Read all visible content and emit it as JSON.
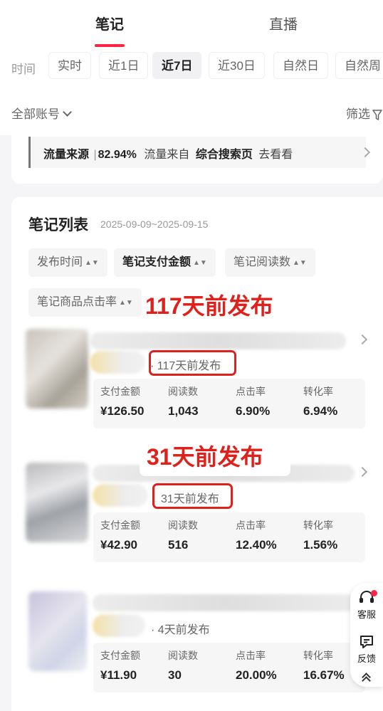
{
  "tabs": {
    "notes": "笔记",
    "live": "直播"
  },
  "time_filter": {
    "label": "时间",
    "options": [
      "实时",
      "近1日",
      "近7日",
      "近30日",
      "自然日",
      "自然周"
    ],
    "selected": "近7日"
  },
  "account_filter": {
    "label": "全部账号"
  },
  "filter_button": {
    "label": "筛选"
  },
  "traffic": {
    "label": "流量来源",
    "percent": "82.94%",
    "from_text": "流量来自",
    "source": "综合搜索页",
    "action": "去看看"
  },
  "note_list": {
    "title": "笔记列表",
    "date_range": "2025-09-09~2025-09-15",
    "sort_options": [
      "发布时间",
      "笔记支付金额",
      "笔记阅读数",
      "笔记商品点击率"
    ],
    "selected_sort": "笔记支付金额",
    "metric_labels": {
      "pay": "支付金额",
      "reads": "阅读数",
      "ctr": "点击率",
      "cvr": "转化率"
    },
    "notes": [
      {
        "age": "117天前发布",
        "pay": "¥126.50",
        "reads": "1,043",
        "ctr": "6.90%",
        "cvr": "6.94%"
      },
      {
        "age": "31天前发布",
        "pay": "¥42.90",
        "reads": "516",
        "ctr": "12.40%",
        "cvr": "1.56%"
      },
      {
        "age": "4天前发布",
        "pay": "¥11.90",
        "reads": "30",
        "ctr": "20.00%",
        "cvr": "16.67%"
      }
    ]
  },
  "annotations": [
    "117天前发布",
    "31天前发布"
  ],
  "side_bar": {
    "service": "客服",
    "feedback": "反馈"
  },
  "colors": {
    "accent": "#ff2442",
    "annotation": "#e0201b"
  }
}
